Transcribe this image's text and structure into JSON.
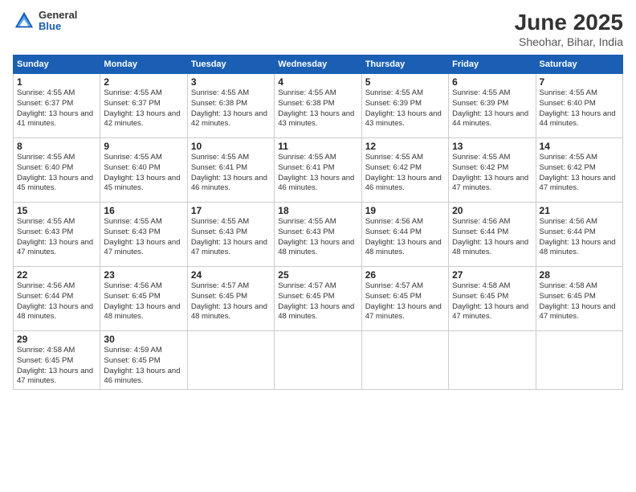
{
  "logo": {
    "general": "General",
    "blue": "Blue"
  },
  "header": {
    "title": "June 2025",
    "subtitle": "Sheohar, Bihar, India"
  },
  "weekdays": [
    "Sunday",
    "Monday",
    "Tuesday",
    "Wednesday",
    "Thursday",
    "Friday",
    "Saturday"
  ],
  "weeks": [
    [
      {
        "day": 1,
        "sunrise": "4:55 AM",
        "sunset": "6:37 PM",
        "daylight": "13 hours and 41 minutes."
      },
      {
        "day": 2,
        "sunrise": "4:55 AM",
        "sunset": "6:37 PM",
        "daylight": "13 hours and 42 minutes."
      },
      {
        "day": 3,
        "sunrise": "4:55 AM",
        "sunset": "6:38 PM",
        "daylight": "13 hours and 42 minutes."
      },
      {
        "day": 4,
        "sunrise": "4:55 AM",
        "sunset": "6:38 PM",
        "daylight": "13 hours and 43 minutes."
      },
      {
        "day": 5,
        "sunrise": "4:55 AM",
        "sunset": "6:39 PM",
        "daylight": "13 hours and 43 minutes."
      },
      {
        "day": 6,
        "sunrise": "4:55 AM",
        "sunset": "6:39 PM",
        "daylight": "13 hours and 44 minutes."
      },
      {
        "day": 7,
        "sunrise": "4:55 AM",
        "sunset": "6:40 PM",
        "daylight": "13 hours and 44 minutes."
      }
    ],
    [
      {
        "day": 8,
        "sunrise": "4:55 AM",
        "sunset": "6:40 PM",
        "daylight": "13 hours and 45 minutes."
      },
      {
        "day": 9,
        "sunrise": "4:55 AM",
        "sunset": "6:40 PM",
        "daylight": "13 hours and 45 minutes."
      },
      {
        "day": 10,
        "sunrise": "4:55 AM",
        "sunset": "6:41 PM",
        "daylight": "13 hours and 46 minutes."
      },
      {
        "day": 11,
        "sunrise": "4:55 AM",
        "sunset": "6:41 PM",
        "daylight": "13 hours and 46 minutes."
      },
      {
        "day": 12,
        "sunrise": "4:55 AM",
        "sunset": "6:42 PM",
        "daylight": "13 hours and 46 minutes."
      },
      {
        "day": 13,
        "sunrise": "4:55 AM",
        "sunset": "6:42 PM",
        "daylight": "13 hours and 47 minutes."
      },
      {
        "day": 14,
        "sunrise": "4:55 AM",
        "sunset": "6:42 PM",
        "daylight": "13 hours and 47 minutes."
      }
    ],
    [
      {
        "day": 15,
        "sunrise": "4:55 AM",
        "sunset": "6:43 PM",
        "daylight": "13 hours and 47 minutes."
      },
      {
        "day": 16,
        "sunrise": "4:55 AM",
        "sunset": "6:43 PM",
        "daylight": "13 hours and 47 minutes."
      },
      {
        "day": 17,
        "sunrise": "4:55 AM",
        "sunset": "6:43 PM",
        "daylight": "13 hours and 47 minutes."
      },
      {
        "day": 18,
        "sunrise": "4:55 AM",
        "sunset": "6:43 PM",
        "daylight": "13 hours and 48 minutes."
      },
      {
        "day": 19,
        "sunrise": "4:56 AM",
        "sunset": "6:44 PM",
        "daylight": "13 hours and 48 minutes."
      },
      {
        "day": 20,
        "sunrise": "4:56 AM",
        "sunset": "6:44 PM",
        "daylight": "13 hours and 48 minutes."
      },
      {
        "day": 21,
        "sunrise": "4:56 AM",
        "sunset": "6:44 PM",
        "daylight": "13 hours and 48 minutes."
      }
    ],
    [
      {
        "day": 22,
        "sunrise": "4:56 AM",
        "sunset": "6:44 PM",
        "daylight": "13 hours and 48 minutes."
      },
      {
        "day": 23,
        "sunrise": "4:56 AM",
        "sunset": "6:45 PM",
        "daylight": "13 hours and 48 minutes."
      },
      {
        "day": 24,
        "sunrise": "4:57 AM",
        "sunset": "6:45 PM",
        "daylight": "13 hours and 48 minutes."
      },
      {
        "day": 25,
        "sunrise": "4:57 AM",
        "sunset": "6:45 PM",
        "daylight": "13 hours and 48 minutes."
      },
      {
        "day": 26,
        "sunrise": "4:57 AM",
        "sunset": "6:45 PM",
        "daylight": "13 hours and 47 minutes."
      },
      {
        "day": 27,
        "sunrise": "4:58 AM",
        "sunset": "6:45 PM",
        "daylight": "13 hours and 47 minutes."
      },
      {
        "day": 28,
        "sunrise": "4:58 AM",
        "sunset": "6:45 PM",
        "daylight": "13 hours and 47 minutes."
      }
    ],
    [
      {
        "day": 29,
        "sunrise": "4:58 AM",
        "sunset": "6:45 PM",
        "daylight": "13 hours and 47 minutes."
      },
      {
        "day": 30,
        "sunrise": "4:59 AM",
        "sunset": "6:45 PM",
        "daylight": "13 hours and 46 minutes."
      },
      null,
      null,
      null,
      null,
      null
    ]
  ]
}
